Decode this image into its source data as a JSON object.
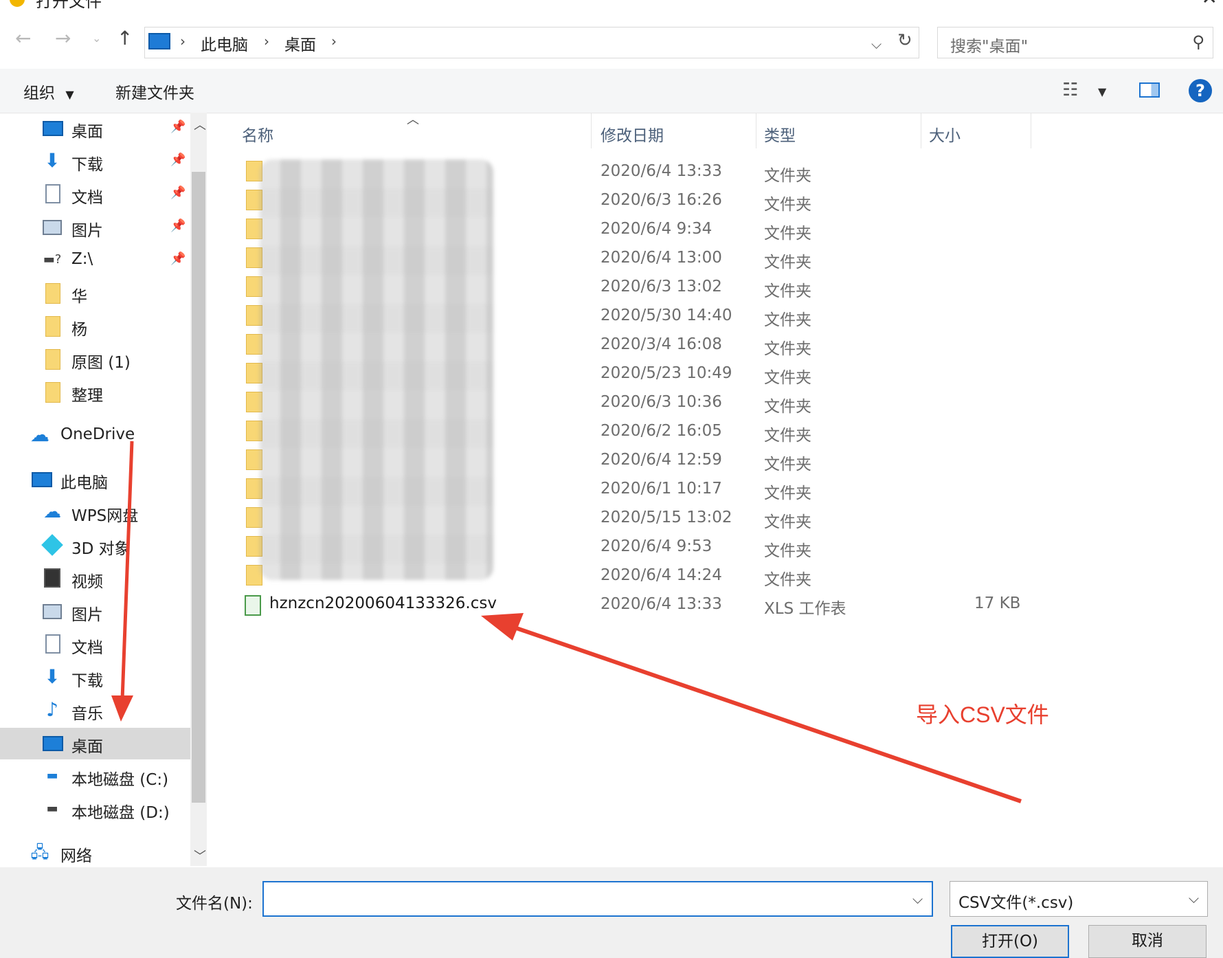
{
  "window": {
    "title": "打开文件"
  },
  "address": {
    "breadcrumbs": [
      "此电脑",
      "桌面"
    ],
    "search_placeholder": "搜索\"桌面\""
  },
  "toolbar": {
    "organize": "组织",
    "new_folder": "新建文件夹"
  },
  "sidebar": {
    "items": [
      {
        "label": "桌面",
        "icon": "desktop-icon",
        "pinned": true
      },
      {
        "label": "下载",
        "icon": "download-icon",
        "pinned": true
      },
      {
        "label": "文档",
        "icon": "document-icon",
        "pinned": true
      },
      {
        "label": "图片",
        "icon": "picture-icon",
        "pinned": true
      },
      {
        "label": "Z:\\",
        "icon": "network-drive-icon",
        "pinned": true
      },
      {
        "label": "华",
        "icon": "folder-icon"
      },
      {
        "label": "杨",
        "icon": "folder-icon"
      },
      {
        "label": "原图 (1)",
        "icon": "folder-icon"
      },
      {
        "label": "整理",
        "icon": "folder-icon"
      },
      {
        "label": "OneDrive",
        "icon": "onedrive-icon"
      },
      {
        "label": "此电脑",
        "icon": "pc-icon"
      },
      {
        "label": "WPS网盘",
        "icon": "wps-cloud-icon"
      },
      {
        "label": "3D 对象",
        "icon": "3d-objects-icon"
      },
      {
        "label": "视频",
        "icon": "video-icon"
      },
      {
        "label": "图片",
        "icon": "picture-icon"
      },
      {
        "label": "文档",
        "icon": "document-icon"
      },
      {
        "label": "下载",
        "icon": "download-icon"
      },
      {
        "label": "音乐",
        "icon": "music-icon"
      },
      {
        "label": "桌面",
        "icon": "desktop-icon",
        "selected": true
      },
      {
        "label": "本地磁盘 (C:)",
        "icon": "drive-c-icon"
      },
      {
        "label": "本地磁盘 (D:)",
        "icon": "drive-d-icon"
      },
      {
        "label": "网络",
        "icon": "network-icon"
      }
    ]
  },
  "columns": {
    "name": "名称",
    "modified": "修改日期",
    "type": "类型",
    "size": "大小"
  },
  "rows": [
    {
      "date": "2020/6/4 13:33",
      "type": "文件夹"
    },
    {
      "date": "2020/6/3 16:26",
      "type": "文件夹"
    },
    {
      "date": "2020/6/4 9:34",
      "type": "文件夹"
    },
    {
      "date": "2020/6/4 13:00",
      "type": "文件夹"
    },
    {
      "date": "2020/6/3 13:02",
      "type": "文件夹"
    },
    {
      "date": "2020/5/30 14:40",
      "type": "文件夹"
    },
    {
      "date": "2020/3/4 16:08",
      "type": "文件夹"
    },
    {
      "date": "2020/5/23 10:49",
      "type": "文件夹"
    },
    {
      "date": "2020/6/3 10:36",
      "type": "文件夹"
    },
    {
      "date": "2020/6/2 16:05",
      "type": "文件夹"
    },
    {
      "date": "2020/6/4 12:59",
      "type": "文件夹"
    },
    {
      "date": "2020/6/1 10:17",
      "type": "文件夹"
    },
    {
      "date": "2020/5/15 13:02",
      "type": "文件夹"
    },
    {
      "date": "2020/6/4 9:53",
      "type": "文件夹"
    },
    {
      "date": "2020/6/4 14:24",
      "type": "文件夹"
    }
  ],
  "csv_file": {
    "name": "hznzcn20200604133326.csv",
    "date": "2020/6/4 13:33",
    "type": "XLS 工作表",
    "size": "17 KB"
  },
  "annotation": {
    "text": "导入CSV文件",
    "color": "#e8402f"
  },
  "bottom": {
    "filename_label": "文件名(N):",
    "filename_value": "",
    "filetype": "CSV文件(*.csv)",
    "open": "打开(O)",
    "cancel": "取消"
  },
  "colors": {
    "accent": "#1c73d0",
    "selected_bg": "#d9d9d9",
    "folder": "#f8d775"
  }
}
